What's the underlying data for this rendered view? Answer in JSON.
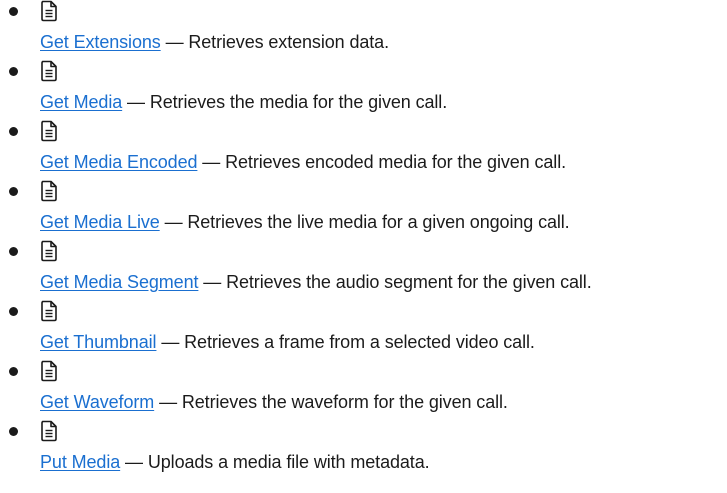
{
  "items": [
    {
      "icon": "document-icon",
      "link": "Get Extensions",
      "separator": " — ",
      "description": "Retrieves extension data."
    },
    {
      "icon": "document-icon",
      "link": "Get Media",
      "separator": " — ",
      "description": "Retrieves the media for the given call."
    },
    {
      "icon": "document-icon",
      "link": "Get Media Encoded",
      "separator": " — ",
      "description": "Retrieves encoded media for the given call."
    },
    {
      "icon": "document-icon",
      "link": "Get Media Live",
      "separator": " — ",
      "description": "Retrieves the live media for a given ongoing call."
    },
    {
      "icon": "document-icon",
      "link": "Get Media Segment",
      "separator": " — ",
      "description": "Retrieves the audio segment for the given call."
    },
    {
      "icon": "document-icon",
      "link": "Get Thumbnail",
      "separator": " — ",
      "description": "Retrieves a frame from a selected video call."
    },
    {
      "icon": "document-icon",
      "link": "Get Waveform",
      "separator": " — ",
      "description": "Retrieves the waveform for the given call."
    },
    {
      "icon": "document-icon",
      "link": "Put Media",
      "separator": " — ",
      "description": "Uploads a media file with metadata."
    }
  ],
  "colors": {
    "link": "#1a6fd0",
    "text": "#1b1b1b"
  }
}
